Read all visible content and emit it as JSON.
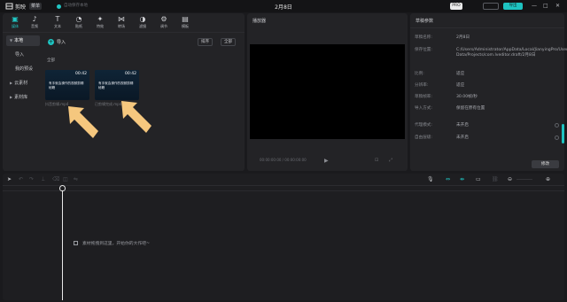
{
  "titlebar": {
    "app_name": "剪映",
    "menu_label": "菜单",
    "autosave_text": "自动保存本地",
    "project_title": "2月8日",
    "pro_badge": "PRO",
    "btn_a_label": "",
    "export_label": "导出",
    "min_icon": "—",
    "max_icon": "□",
    "close_icon": "✕"
  },
  "media_tabs": [
    {
      "label": "媒体",
      "icon": "▣"
    },
    {
      "label": "音频",
      "icon": "♪"
    },
    {
      "label": "文本",
      "icon": "T"
    },
    {
      "label": "贴纸",
      "icon": "◔"
    },
    {
      "label": "特效",
      "icon": "✦"
    },
    {
      "label": "转场",
      "icon": "⋈"
    },
    {
      "label": "滤镜",
      "icon": "◑"
    },
    {
      "label": "调节",
      "icon": "⚙"
    },
    {
      "label": "模板",
      "icon": "▤"
    }
  ],
  "side_nav": {
    "local": "本地",
    "import": "导入",
    "mine": "我的预设",
    "cloud": "云素材",
    "library": "素材库"
  },
  "media": {
    "import_label": "导入",
    "sort_label": "排序",
    "all_filter": "全部",
    "all_label": "全部",
    "clips": [
      {
        "duration": "00:42",
        "title": "有手就会操作的视频剪辑秘籍",
        "name": "抖音剪辑.mp4"
      },
      {
        "duration": "00:42",
        "title": "有手就会操作的视频剪辑秘籍",
        "name": "已剪辑完成.mp4"
      }
    ]
  },
  "player": {
    "title": "播放器",
    "time": "00:00:00:00 / 00:00:00:00",
    "play_icon": "▶",
    "ctrl_a": "⊡",
    "ctrl_b": "⤢"
  },
  "props": {
    "title": "草稿参数",
    "rows": [
      {
        "k": "草稿名称:",
        "v": "2月8日"
      },
      {
        "k": "保存位置:",
        "v": "C:/Users/Administrator/AppData/Local/JianyingPro/User Data/Projects/com.lveditor.draft/2月8日"
      },
      {
        "k": "比例:",
        "v": "适应"
      },
      {
        "k": "分辨率:",
        "v": "适应"
      },
      {
        "k": "草稿帧率:",
        "v": "30.00帧/秒"
      },
      {
        "k": "导入方式:",
        "v": "保留在原有位置"
      },
      {
        "k": "代理模式:",
        "v": "未开启"
      },
      {
        "k": "自由层级:",
        "v": "未开启"
      }
    ],
    "edit_button": "修改"
  },
  "timeline": {
    "drop_hint": "素材拖拽到这里，开始你的大作吧~"
  },
  "colors": {
    "accent": "#1ec3c1",
    "panel": "#232326",
    "background": "#1a1a1d",
    "arrow": "#f5c77e"
  }
}
